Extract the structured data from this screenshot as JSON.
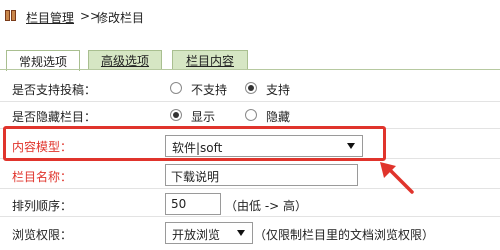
{
  "breadcrumb": {
    "root_label": "栏目管理",
    "separator": ">>",
    "current_label": "修改栏目"
  },
  "tabs": [
    {
      "label": "常规选项",
      "active": true
    },
    {
      "label": "高级选项",
      "active": false
    },
    {
      "label": "栏目内容",
      "active": false
    }
  ],
  "form": {
    "allow_submit": {
      "label": "是否支持投稿：",
      "options": [
        {
          "label": "不支持",
          "checked": false
        },
        {
          "label": "支持",
          "checked": true
        }
      ]
    },
    "hidden": {
      "label": "是否隐藏栏目：",
      "options": [
        {
          "label": "显示",
          "checked": true
        },
        {
          "label": "隐藏",
          "checked": false
        }
      ]
    },
    "content_model": {
      "label": "内容模型：",
      "value": "软件|soft"
    },
    "column_name": {
      "label": "栏目名称：",
      "value": "下载说明"
    },
    "sort_order": {
      "label": "排列顺序：",
      "value": "50",
      "hint": "（由低 -> 高）"
    },
    "browse_permission": {
      "label": "浏览权限：",
      "value": "开放浏览",
      "hint": "（仅限制栏目里的文档浏览权限）"
    }
  },
  "colors": {
    "highlight": "#e0342c",
    "tab_bg": "#d6e6c4"
  }
}
